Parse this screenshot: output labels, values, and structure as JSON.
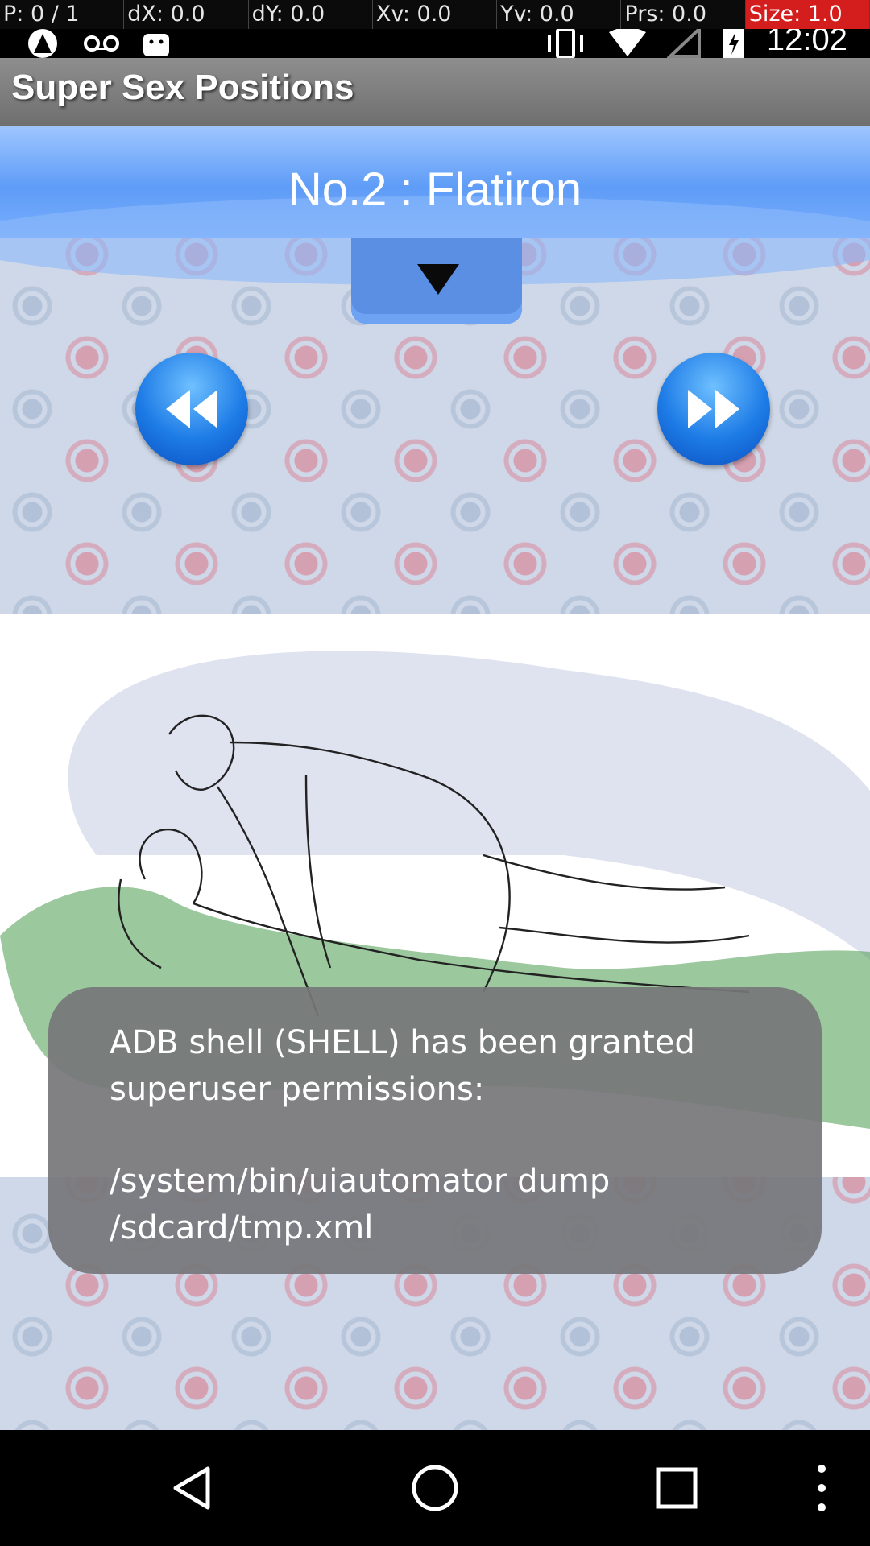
{
  "debug_bar": {
    "p": "P: 0 / 1",
    "dx": "dX: 0.0",
    "dy": "dY: 0.0",
    "xv": "Xv: 0.0",
    "yv": "Yv: 0.0",
    "prs": "Prs: 0.0",
    "size": "Size: 1.0"
  },
  "status_bar": {
    "time": "12:02",
    "icons": [
      "notification-icon",
      "voicemail-icon",
      "android-debug-icon",
      "vibrate-icon",
      "wifi-icon",
      "cellular-signal-icon",
      "battery-charging-icon"
    ]
  },
  "app": {
    "title": "Super Sex Positions"
  },
  "position": {
    "title": "No.2 : Flatiron"
  },
  "controls": {
    "dropdown_icon": "chevron-down-icon",
    "prev_icon": "rewind-icon",
    "next_icon": "fast-forward-icon"
  },
  "toast": {
    "line1": "ADB shell (SHELL) has been granted superuser permissions:",
    "line2": "/system/bin/uiautomator dump /sdcard/tmp.xml"
  },
  "nav_bar": {
    "icons": [
      "back-icon",
      "home-icon",
      "recents-icon",
      "overflow-menu-icon"
    ]
  },
  "colors": {
    "header_blue": "#5e9cf7",
    "button_blue": "#1d7be6",
    "toast_bg": "#76767a",
    "debug_size_red": "#d41e1e"
  }
}
